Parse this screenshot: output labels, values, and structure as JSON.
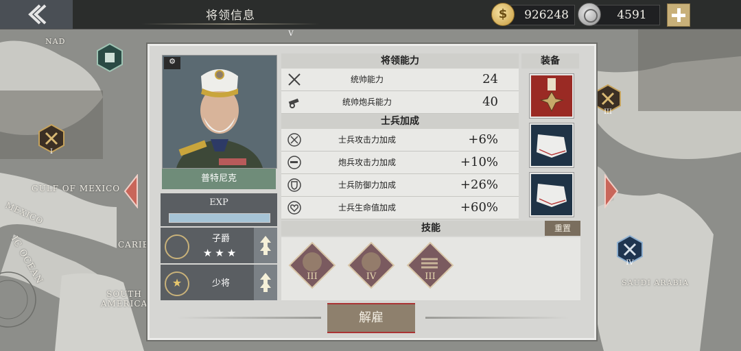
{
  "header": {
    "title": "将领信息"
  },
  "resources": {
    "gold": "926248",
    "silver": "4591",
    "gold_icon": "dollar-coin-icon",
    "silver_icon": "silver-medal-icon"
  },
  "map_labels": {
    "gulf": "GULF OF MEXICO",
    "mexico": "MEXICO",
    "ocean": "IC OCEAN",
    "south_america": "SOUTH\nAMERICA",
    "saudi": "SAUDI ARABIA",
    "carib": "CARIB",
    "nad": "NAD",
    "hex_I": "I",
    "hex_III": "III",
    "hex_IV": "IV",
    "hex_V": "V"
  },
  "general": {
    "name": "普特尼克",
    "exp_label": "EXP",
    "exp_progress": 1.0,
    "title_rank": "子爵",
    "title_stars": 3,
    "military_rank": "少将"
  },
  "abilities": {
    "heading": "将领能力",
    "rows": [
      {
        "icon": "crossed-swords-icon",
        "label": "统帅能力",
        "value": "24"
      },
      {
        "icon": "cannon-icon",
        "label": "统帅炮兵能力",
        "value": "40"
      }
    ]
  },
  "bonus": {
    "heading": "士兵加成",
    "rows": [
      {
        "icon": "attack-up-icon",
        "label": "士兵攻击力加成",
        "value": "+6%"
      },
      {
        "icon": "artillery-up-icon",
        "label": "炮兵攻击力加成",
        "value": "+10%"
      },
      {
        "icon": "shield-up-icon",
        "label": "士兵防御力加成",
        "value": "+26%"
      },
      {
        "icon": "heart-up-icon",
        "label": "士兵生命值加成",
        "value": "+60%"
      }
    ]
  },
  "equipment": {
    "heading": "装备",
    "items": [
      "medal-cross-icon",
      "white-cloth-icon",
      "white-cloth-icon"
    ]
  },
  "skills": {
    "heading": "技能",
    "reset_label": "重置",
    "items": [
      {
        "icon": "cannon-skill-icon",
        "level": "III"
      },
      {
        "icon": "cannon-skill-icon",
        "level": "IV"
      },
      {
        "icon": "shells-skill-icon",
        "level": "III"
      }
    ]
  },
  "actions": {
    "dismiss_label": "解雇"
  },
  "colors": {
    "accent_gold": "#c8b079",
    "panel_bg": "#d6d6d3",
    "skill_bg": "#7a5a5f",
    "portrait_bg": "#6f8c79"
  }
}
